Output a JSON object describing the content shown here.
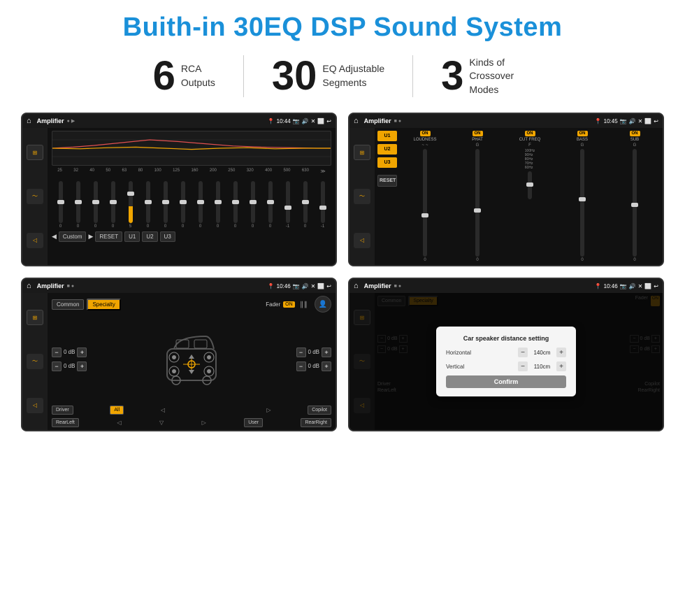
{
  "title": "Buith-in 30EQ DSP Sound System",
  "stats": [
    {
      "number": "6",
      "label": "RCA\nOutputs"
    },
    {
      "number": "30",
      "label": "EQ Adjustable\nSegments"
    },
    {
      "number": "3",
      "label": "Kinds of\nCrossover Modes"
    }
  ],
  "screens": [
    {
      "id": "eq-screen",
      "status_title": "Amplifier",
      "status_time": "10:44",
      "type": "eq"
    },
    {
      "id": "mixer-screen",
      "status_title": "Amplifier",
      "status_time": "10:45",
      "type": "mixer"
    },
    {
      "id": "fader-screen",
      "status_title": "Amplifier",
      "status_time": "10:46",
      "type": "fader"
    },
    {
      "id": "dialog-screen",
      "status_title": "Amplifier",
      "status_time": "10:46",
      "type": "dialog"
    }
  ],
  "eq": {
    "freqs": [
      "25",
      "32",
      "40",
      "50",
      "63",
      "80",
      "100",
      "125",
      "160",
      "200",
      "250",
      "320",
      "400",
      "500",
      "630"
    ],
    "values": [
      "0",
      "0",
      "0",
      "0",
      "5",
      "0",
      "0",
      "0",
      "0",
      "0",
      "0",
      "0",
      "0",
      "-1",
      "0",
      "-1"
    ],
    "thumb_positions": [
      50,
      50,
      50,
      50,
      20,
      50,
      50,
      50,
      50,
      50,
      50,
      50,
      50,
      65,
      50,
      65
    ],
    "bottom_buttons": [
      "◀",
      "Custom",
      "▶",
      "RESET",
      "U1",
      "U2",
      "U3"
    ]
  },
  "mixer": {
    "presets": [
      "U1",
      "U2",
      "U3"
    ],
    "reset_label": "RESET",
    "channels": [
      {
        "on": true,
        "label": "LOUDNESS"
      },
      {
        "on": true,
        "label": "PHAT"
      },
      {
        "on": true,
        "label": "CUT FREQ"
      },
      {
        "on": true,
        "label": "BASS"
      },
      {
        "on": true,
        "label": "SUB"
      }
    ]
  },
  "fader": {
    "common_label": "Common",
    "specialty_label": "Specialty",
    "fader_label": "Fader",
    "on_label": "ON",
    "db_rows": [
      {
        "value": "0 dB"
      },
      {
        "value": "0 dB"
      },
      {
        "value": "0 dB"
      },
      {
        "value": "0 dB"
      }
    ],
    "bottom_btns": [
      "Driver",
      "All",
      "Copilot",
      "RearLeft",
      "User",
      "RearRight"
    ]
  },
  "dialog": {
    "title": "Car speaker distance setting",
    "horizontal_label": "Horizontal",
    "horizontal_value": "140cm",
    "vertical_label": "Vertical",
    "vertical_value": "110cm",
    "confirm_label": "Confirm",
    "db_right1": "0 dB",
    "db_right2": "0 dB",
    "driver_label": "Driver",
    "copilot_label": "Copilot",
    "rearleft_label": "RearLeft",
    "rearright_label": "RearRight"
  }
}
